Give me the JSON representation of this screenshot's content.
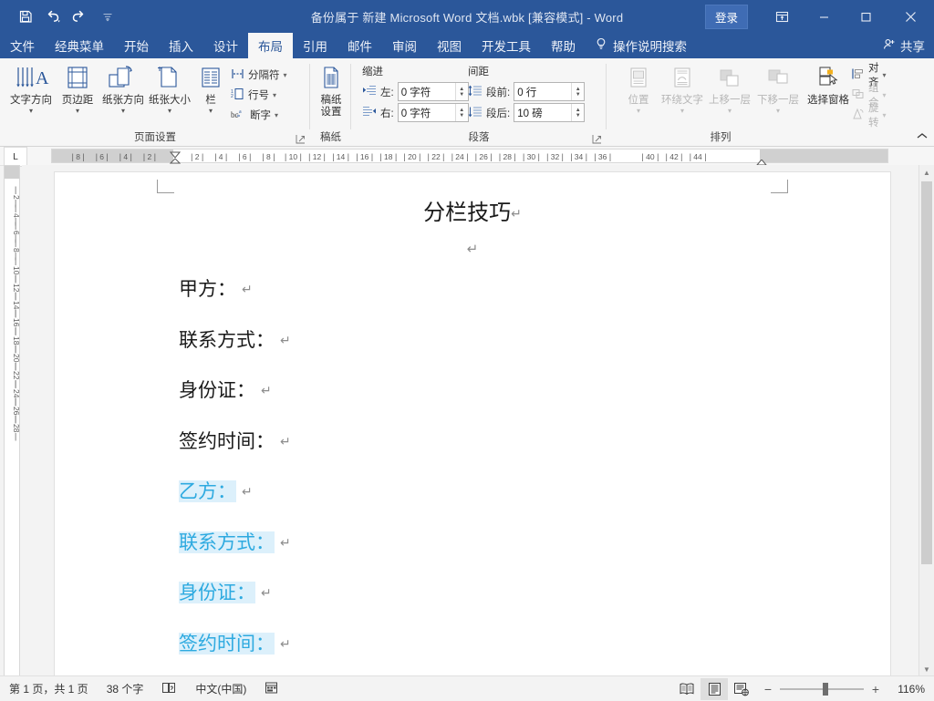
{
  "window": {
    "title": "备份属于 新建 Microsoft Word 文档.wbk [兼容模式]  -  Word",
    "signin_label": "登录",
    "qat": [
      {
        "name": "save",
        "glyph": "save-icon"
      },
      {
        "name": "undo",
        "glyph": "undo-icon"
      },
      {
        "name": "redo",
        "glyph": "redo-icon"
      },
      {
        "name": "customize",
        "glyph": "chevron-down-icon"
      }
    ],
    "controls": {
      "ribbon_display": "ribbon-display-options-icon",
      "minimize": "minimize-icon",
      "maximize": "maximize-icon",
      "close": "close-icon"
    }
  },
  "tabs": [
    {
      "label": "文件",
      "active": false
    },
    {
      "label": "经典菜单",
      "active": false
    },
    {
      "label": "开始",
      "active": false
    },
    {
      "label": "插入",
      "active": false
    },
    {
      "label": "设计",
      "active": false
    },
    {
      "label": "布局",
      "active": true
    },
    {
      "label": "引用",
      "active": false
    },
    {
      "label": "邮件",
      "active": false
    },
    {
      "label": "审阅",
      "active": false
    },
    {
      "label": "视图",
      "active": false
    },
    {
      "label": "开发工具",
      "active": false
    },
    {
      "label": "帮助",
      "active": false
    }
  ],
  "tell_me": {
    "label": "操作说明搜索",
    "icon": "lightbulb-icon"
  },
  "share": {
    "label": "共享",
    "icon": "share-person-icon"
  },
  "ribbon": {
    "groups": [
      {
        "name": "page-setup",
        "label": "页面设置",
        "big_buttons": [
          {
            "label": "文字方向",
            "icon": "text-direction-icon",
            "has_caret": true,
            "disabled": false
          },
          {
            "label": "页边距",
            "icon": "margins-icon",
            "has_caret": true,
            "disabled": false
          },
          {
            "label": "纸张方向",
            "icon": "orientation-icon",
            "has_caret": true,
            "disabled": false
          },
          {
            "label": "纸张大小",
            "icon": "paper-size-icon",
            "has_caret": true,
            "disabled": false
          },
          {
            "label": "栏",
            "icon": "columns-icon",
            "has_caret": true,
            "disabled": false
          }
        ],
        "small_buttons": [
          {
            "label": "分隔符",
            "icon": "breaks-icon",
            "has_caret": true,
            "disabled": false
          },
          {
            "label": "行号",
            "icon": "line-numbers-icon",
            "has_caret": true,
            "disabled": false
          },
          {
            "label": "断字",
            "icon": "hyphenation-icon",
            "has_caret": true,
            "disabled": false
          }
        ]
      },
      {
        "name": "manuscript-paper",
        "label": "稿纸",
        "big_buttons": [
          {
            "label": "稿纸\n设置",
            "label_line1": "稿纸",
            "label_line2": "设置",
            "icon": "manuscript-settings-icon",
            "has_caret": false,
            "disabled": false
          }
        ]
      },
      {
        "name": "paragraph",
        "label": "段落",
        "section_labels": {
          "indent": "缩进",
          "spacing": "间距"
        },
        "fields": [
          {
            "name": "indent-left",
            "label": "左:",
            "value": "0 字符",
            "icon": "indent-left-icon"
          },
          {
            "name": "indent-right",
            "label": "右:",
            "value": "0 字符",
            "icon": "indent-right-icon"
          },
          {
            "name": "spacing-before",
            "label": "段前:",
            "value": "0 行",
            "icon": "space-before-icon"
          },
          {
            "name": "spacing-after",
            "label": "段后:",
            "value": "10 磅",
            "icon": "space-after-icon"
          }
        ]
      },
      {
        "name": "arrange",
        "label": "排列",
        "big_buttons": [
          {
            "label": "位置",
            "icon": "position-icon",
            "has_caret": true,
            "disabled": true
          },
          {
            "label": "环绕文字",
            "icon": "wrap-text-icon",
            "has_caret": true,
            "disabled": true
          },
          {
            "label": "上移一层",
            "icon": "bring-forward-icon",
            "has_caret": true,
            "disabled": true
          },
          {
            "label": "下移一层",
            "icon": "send-backward-icon",
            "has_caret": true,
            "disabled": true
          },
          {
            "label": "选择窗格",
            "icon": "selection-pane-icon",
            "has_caret": false,
            "disabled": false
          }
        ],
        "small_buttons": [
          {
            "label": "对齐",
            "icon": "align-objects-icon",
            "has_caret": true,
            "disabled": false
          },
          {
            "label": "组合",
            "icon": "group-objects-icon",
            "has_caret": true,
            "disabled": true
          },
          {
            "label": "旋转",
            "icon": "rotate-objects-icon",
            "has_caret": true,
            "disabled": true
          }
        ]
      }
    ],
    "collapse_icon": "chevron-up-icon"
  },
  "ruler": {
    "tab_stop_label": "L",
    "horizontal_ticks": [
      "8",
      "6",
      "4",
      "2",
      "",
      "2",
      "4",
      "6",
      "8",
      "10",
      "12",
      "14",
      "16",
      "18",
      "20",
      "22",
      "24",
      "26",
      "28",
      "30",
      "32",
      "34",
      "36",
      "",
      "40",
      "42",
      "44"
    ],
    "vertical_ticks": [
      "2",
      "4",
      "6",
      "8",
      "10",
      "12",
      "14",
      "16",
      "18",
      "20",
      "22",
      "24",
      "26",
      "28"
    ]
  },
  "document": {
    "title": "分栏技巧",
    "blank_paragraph_mark": "↵",
    "lines": [
      {
        "text": "甲方：",
        "color": "#1a1a1a",
        "selected": false,
        "mark": "↵"
      },
      {
        "text": "联系方式：",
        "color": "#1a1a1a",
        "selected": false,
        "mark": "↵"
      },
      {
        "text": "身份证：",
        "color": "#1a1a1a",
        "selected": false,
        "mark": "↵"
      },
      {
        "text": "签约时间：",
        "color": "#1a1a1a",
        "selected": false,
        "mark": "↵"
      },
      {
        "text": "乙方：",
        "color": "#2eaae0",
        "selected": true,
        "mark": "↵"
      },
      {
        "text": "联系方式：",
        "color": "#2eaae0",
        "selected": true,
        "mark": "↵"
      },
      {
        "text": "身份证：",
        "color": "#2eaae0",
        "selected": true,
        "mark": "↵"
      },
      {
        "text": "签约时间：",
        "color": "#2eaae0",
        "selected": true,
        "mark": "↵"
      }
    ]
  },
  "statusbar": {
    "page_info": "第 1 页，共 1 页",
    "word_count": "38 个字",
    "proofing_icon": "proofing-icon",
    "language": "中文(中国)",
    "accessibility_icon": "accessibility-icon",
    "views": [
      {
        "name": "read-mode",
        "icon": "read-mode-icon",
        "active": false
      },
      {
        "name": "print-layout",
        "icon": "print-layout-icon",
        "active": true
      },
      {
        "name": "web-layout",
        "icon": "web-layout-icon",
        "active": false
      }
    ],
    "zoom": {
      "minus": "−",
      "plus": "+",
      "percent": "116%",
      "value": 116
    }
  },
  "colors": {
    "title_bar": "#2b579a",
    "ribbon_bg": "#f6f6f6",
    "accent_text": "#2eaae0",
    "selection": "#dcf0fb"
  }
}
